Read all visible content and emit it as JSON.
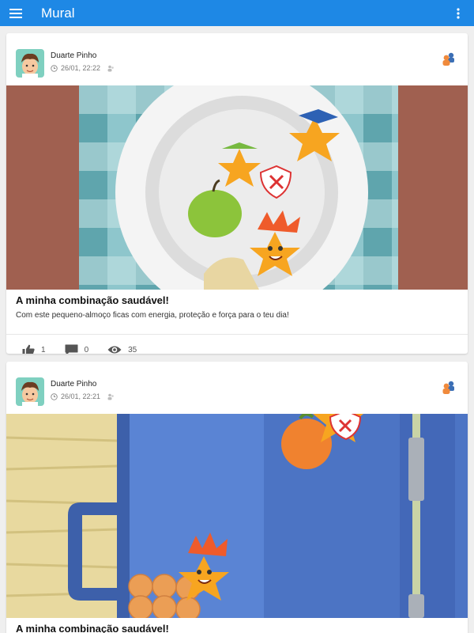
{
  "appbar": {
    "title": "Mural",
    "menu_icon": "hamburger-icon",
    "more_icon": "more-vert-icon"
  },
  "posts": [
    {
      "author": "Duarte Pinho",
      "timestamp": "26/01, 22:22",
      "title": "A minha combinação saudável!",
      "text": "Com este pequeno-almoço ficas com energia, proteção e força para o teu dia!",
      "likes": "1",
      "comments": "0",
      "views": "35"
    },
    {
      "author": "Duarte Pinho",
      "timestamp": "26/01, 22:21",
      "title": "A minha combinação saudável!"
    }
  ],
  "colors": {
    "appbar": "#1e88e5",
    "background": "#efefef",
    "accent_orange": "#f7a520"
  }
}
